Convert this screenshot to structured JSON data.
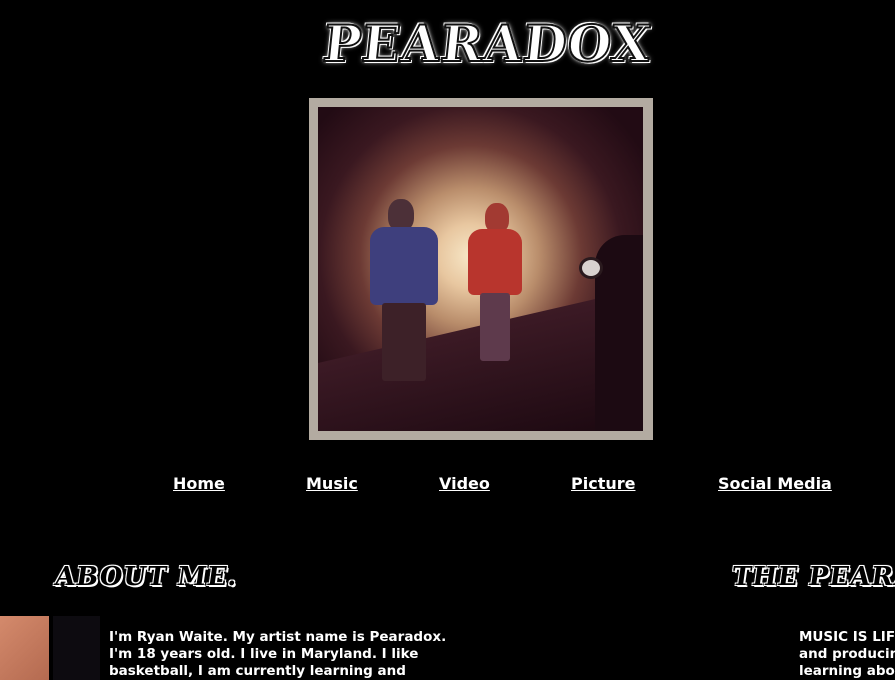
{
  "header": {
    "logo_text": "PEARADOX"
  },
  "nav": {
    "items": [
      {
        "label": "Home"
      },
      {
        "label": "Music"
      },
      {
        "label": "Video"
      },
      {
        "label": "Picture"
      },
      {
        "label": "Social Media"
      }
    ]
  },
  "about": {
    "title": "ABOUT ME.",
    "text": "I'm Ryan Waite. My artist name is Pearadox. I'm 18 years old. I live in Maryland. I like basketball, I am currently learning and"
  },
  "right_section": {
    "title": "THE PEARADOX",
    "lines": [
      "MUSIC IS LIFE",
      "and producing",
      "learning about"
    ]
  },
  "colors": {
    "background": "#000000",
    "frame": "#b3aba1",
    "text": "#ffffff"
  }
}
